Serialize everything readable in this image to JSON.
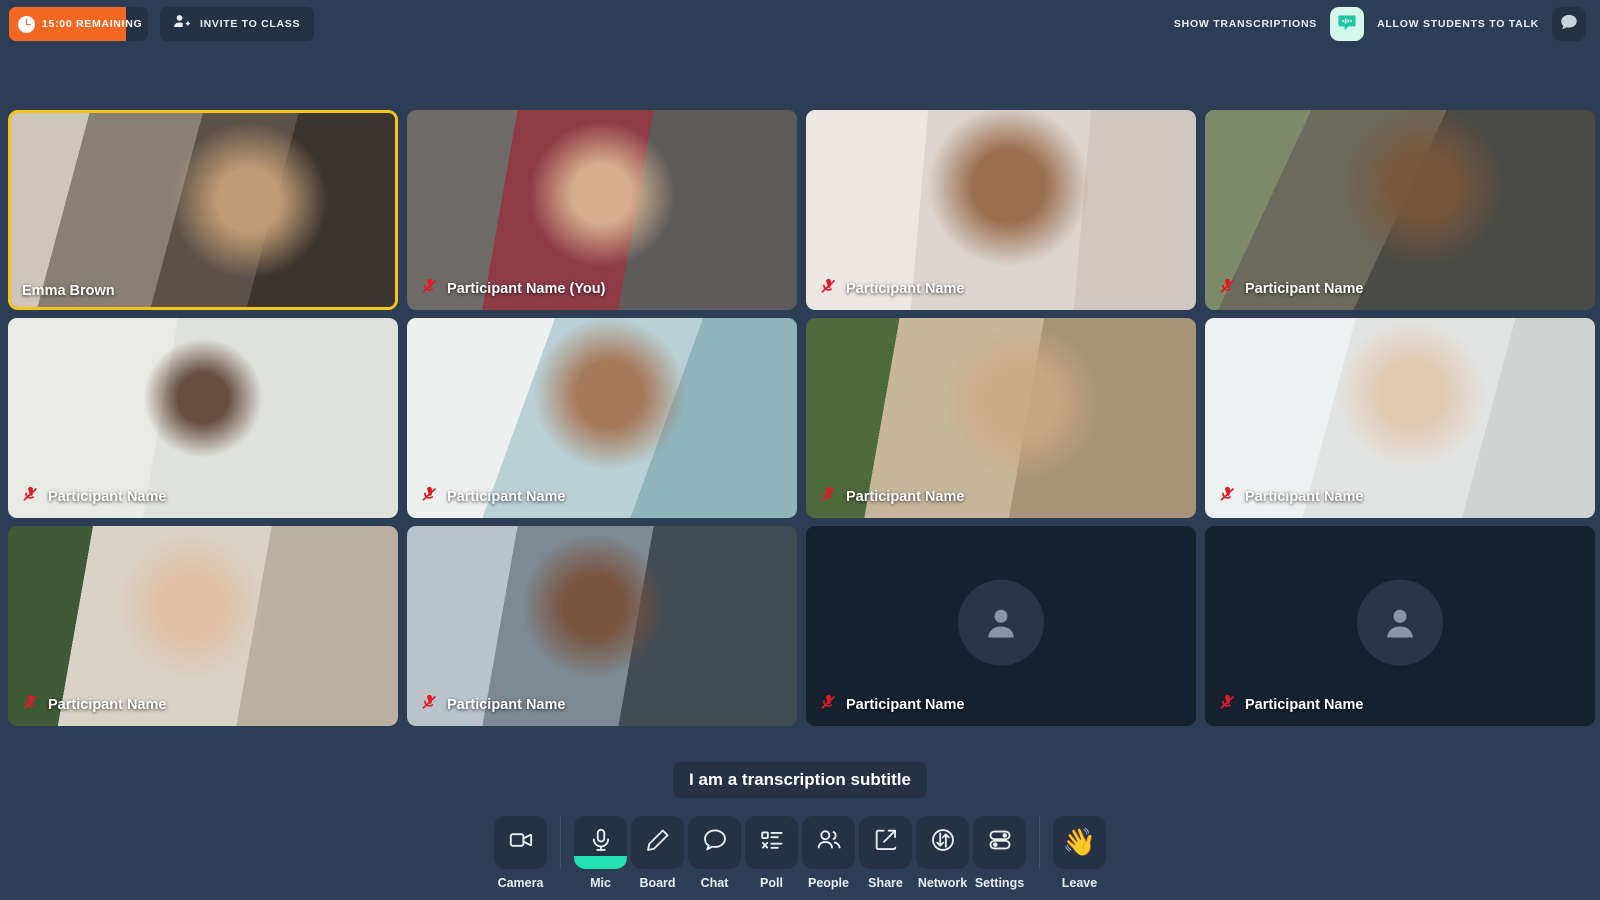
{
  "topbar": {
    "timer_text": "15:00 REMAINING",
    "timer_progress": 84,
    "timer_color": "#f26722",
    "invite_label": "INVITE TO CLASS",
    "show_transcriptions_label": "SHOW TRANSCRIPTIONS",
    "allow_students_label": "ALLOW STUDENTS TO TALK",
    "transcription_toggle_state": "on",
    "transcription_toggle_color": "#d6f7ec",
    "talk_toggle_state": "off"
  },
  "grid": {
    "active_speaker": "Emma Brown",
    "active_border_color": "#f5c518",
    "muted_icon_color": "#e01b24",
    "tiles": [
      {
        "name": "Emma Brown",
        "muted": false,
        "active": true,
        "empty": false,
        "photo": "ph-1"
      },
      {
        "name": "Participant Name (You)",
        "muted": true,
        "active": false,
        "empty": false,
        "photo": "ph-2"
      },
      {
        "name": "Participant Name",
        "muted": true,
        "active": false,
        "empty": false,
        "photo": "ph-3"
      },
      {
        "name": "Participant Name",
        "muted": true,
        "active": false,
        "empty": false,
        "photo": "ph-4"
      },
      {
        "name": "Participant Name",
        "muted": true,
        "active": false,
        "empty": false,
        "photo": "ph-5"
      },
      {
        "name": "Participant Name",
        "muted": true,
        "active": false,
        "empty": false,
        "photo": "ph-6"
      },
      {
        "name": "Participant Name",
        "muted": true,
        "active": false,
        "empty": false,
        "photo": "ph-7"
      },
      {
        "name": "Participant Name",
        "muted": true,
        "active": false,
        "empty": false,
        "photo": "ph-8"
      },
      {
        "name": "Participant Name",
        "muted": true,
        "active": false,
        "empty": false,
        "photo": "ph-9"
      },
      {
        "name": "Participant Name",
        "muted": true,
        "active": false,
        "empty": false,
        "photo": "ph-10"
      },
      {
        "name": "Participant Name",
        "muted": true,
        "active": false,
        "empty": true,
        "photo": ""
      },
      {
        "name": "Participant Name",
        "muted": true,
        "active": false,
        "empty": true,
        "photo": ""
      }
    ]
  },
  "subtitle": {
    "text": "I am a transcription subtitle"
  },
  "toolbar": {
    "mic_active_color": "#25e0b0",
    "items": [
      {
        "label": "Camera",
        "icon": "camera-icon",
        "active": false,
        "separator_after": true
      },
      {
        "label": "Mic",
        "icon": "mic-icon",
        "active": true,
        "separator_after": false
      },
      {
        "label": "Board",
        "icon": "pencil-icon",
        "active": false,
        "separator_after": false
      },
      {
        "label": "Chat",
        "icon": "chat-icon",
        "active": false,
        "separator_after": false
      },
      {
        "label": "Poll",
        "icon": "poll-icon",
        "active": false,
        "separator_after": false
      },
      {
        "label": "People",
        "icon": "people-icon",
        "active": false,
        "separator_after": false
      },
      {
        "label": "Share",
        "icon": "share-icon",
        "active": false,
        "separator_after": false
      },
      {
        "label": "Network",
        "icon": "network-icon",
        "active": false,
        "separator_after": false
      },
      {
        "label": "Settings",
        "icon": "settings-icon",
        "active": false,
        "separator_after": true
      },
      {
        "label": "Leave",
        "icon": "wave-hand-icon",
        "active": false,
        "separator_after": false
      }
    ]
  }
}
